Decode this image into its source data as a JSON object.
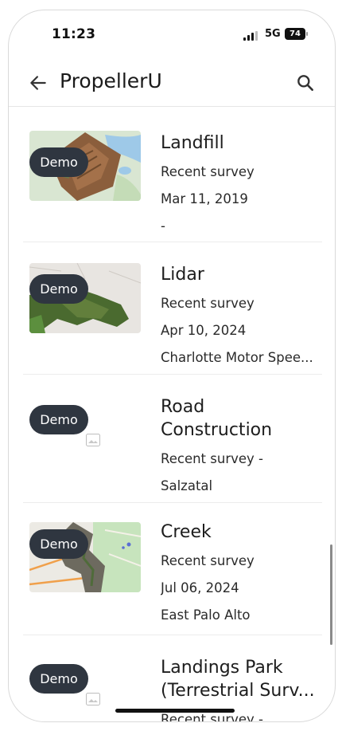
{
  "status_bar": {
    "time": "11:23",
    "network": "5G",
    "battery": "74"
  },
  "app_bar": {
    "title": "PropellerU",
    "back_icon": "arrow-left-icon",
    "search_icon": "search-icon"
  },
  "projects": [
    {
      "name": "Landfill",
      "name_line2": "",
      "subtitle": "Recent survey",
      "date": "Mar 11, 2019",
      "location": "-",
      "badge": "Demo"
    },
    {
      "name": "Lidar",
      "name_line2": "",
      "subtitle": "Recent survey",
      "date": "Apr 10, 2024",
      "location": "Charlotte Motor Spee...",
      "badge": "Demo"
    },
    {
      "name": "Road",
      "name_line2": "Construction",
      "subtitle": "Recent survey  -",
      "date": "",
      "location": "Salzatal",
      "badge": "Demo"
    },
    {
      "name": "Creek",
      "name_line2": "",
      "subtitle": "Recent survey",
      "date": "Jul 06, 2024",
      "location": "East Palo Alto",
      "badge": "Demo"
    },
    {
      "name": "Landings Park",
      "name_line2": "(Terrestrial Surv...",
      "subtitle": "Recent survey  -",
      "date": "",
      "location": "",
      "badge": "Demo"
    }
  ]
}
